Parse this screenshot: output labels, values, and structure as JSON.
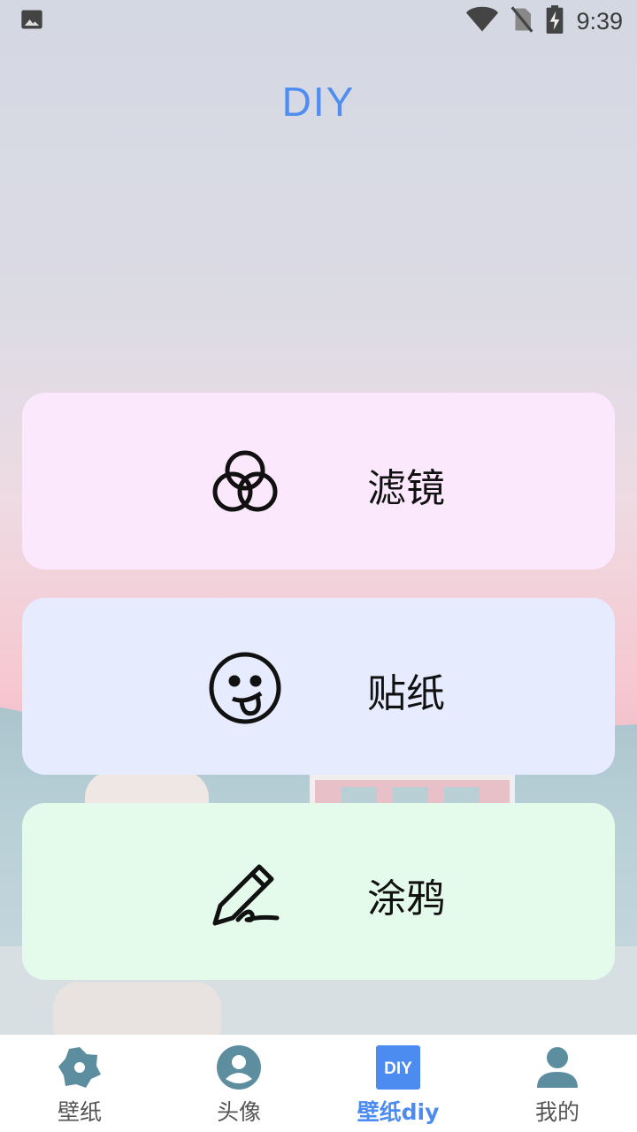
{
  "status_bar": {
    "time": "9:39",
    "icons": [
      "image-icon",
      "wifi-icon",
      "no-sim-icon",
      "battery-charging-icon"
    ]
  },
  "page": {
    "title": "DIY"
  },
  "cards": [
    {
      "label": "滤镜",
      "icon": "filter-circles-icon",
      "color": "#fce8fd"
    },
    {
      "label": "贴纸",
      "icon": "tongue-face-icon",
      "color": "#e6ebfd"
    },
    {
      "label": "涂鸦",
      "icon": "pen-scribble-icon",
      "color": "#e4fbec"
    }
  ],
  "bottom_nav": {
    "items": [
      {
        "label": "壁纸",
        "icon": "wallpaper-flower-icon"
      },
      {
        "label": "头像",
        "icon": "avatar-circle-icon"
      },
      {
        "label": "壁纸diy",
        "icon": "diy-badge-icon",
        "active": true,
        "badge_text": "DIY"
      },
      {
        "label": "我的",
        "icon": "person-icon"
      }
    ]
  },
  "colors": {
    "accent": "#4c8cf0",
    "nav_icon": "#5d8ea0"
  }
}
